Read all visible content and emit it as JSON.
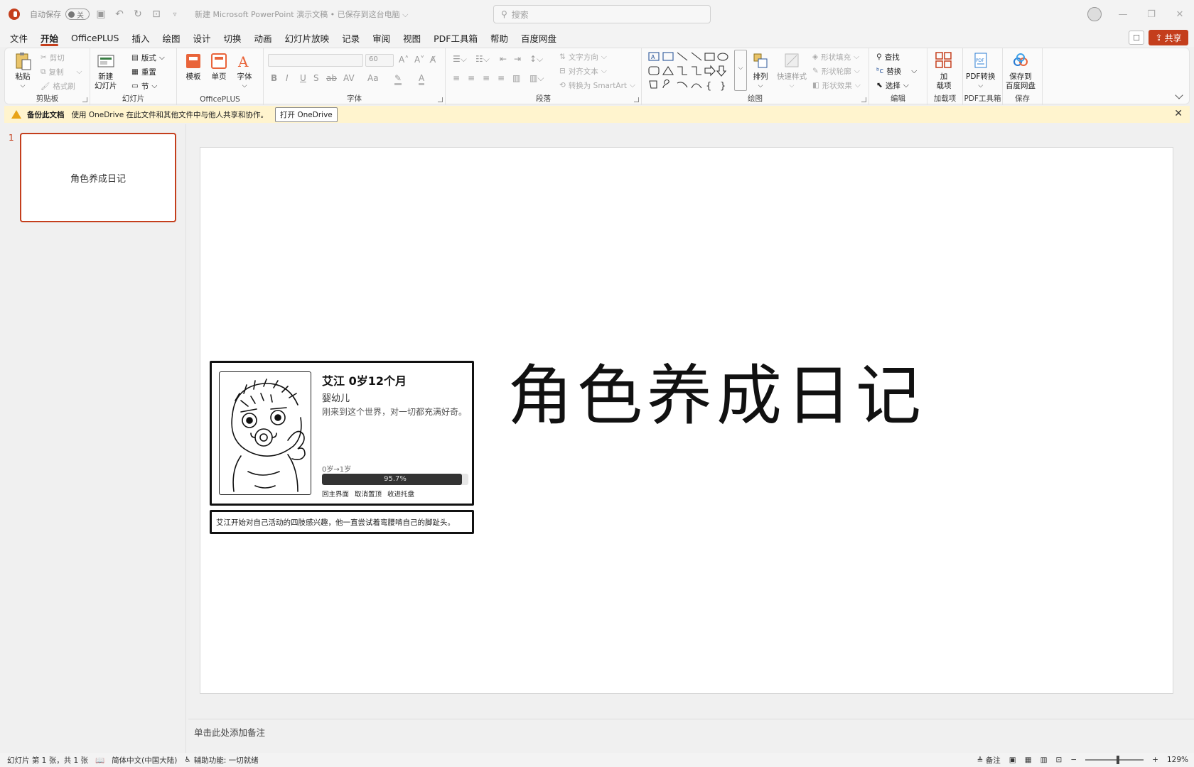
{
  "titlebar": {
    "autosave_label": "自动保存",
    "autosave_state": "关",
    "doc_title": "新建 Microsoft PowerPoint 演示文稿 • 已保存到这台电脑 ⌵",
    "search_placeholder": "搜索"
  },
  "tabs": [
    "文件",
    "开始",
    "OfficePLUS",
    "插入",
    "绘图",
    "设计",
    "切换",
    "动画",
    "幻灯片放映",
    "记录",
    "审阅",
    "视图",
    "PDF工具箱",
    "帮助",
    "百度网盘"
  ],
  "active_tab": "开始",
  "share_label": "共享",
  "ribbon": {
    "clipboard": {
      "paste": "粘贴",
      "cut": "剪切",
      "copy": "复制",
      "format_painter": "格式刷",
      "label": "剪贴板"
    },
    "slides": {
      "new_slide": "新建\n幻灯片",
      "layout": "版式",
      "reset": "重置",
      "section": "节",
      "label": "幻灯片"
    },
    "officeplus": {
      "template": "模板",
      "single_page": "单页",
      "font": "字体",
      "label": "OfficePLUS"
    },
    "font": {
      "size": "60",
      "label": "字体"
    },
    "paragraph": {
      "text_direction": "文字方向",
      "align_text": "对齐文本",
      "smartart": "转换为 SmartArt",
      "label": "段落"
    },
    "drawing": {
      "arrange": "排列",
      "quick_styles": "快速样式",
      "shape_fill": "形状填充",
      "shape_outline": "形状轮廓",
      "shape_effects": "形状效果",
      "label": "绘图"
    },
    "editing": {
      "find": "查找",
      "replace": "替换",
      "select": "选择",
      "label": "编辑"
    },
    "addins": {
      "button": "加\n载项",
      "label": "加载项"
    },
    "pdf": {
      "button": "PDF转换",
      "label": "PDF工具箱"
    },
    "save": {
      "button": "保存到\n百度网盘",
      "label": "保存"
    }
  },
  "notification": {
    "title": "备份此文档",
    "message": "使用 OneDrive 在此文件和其他文件中与他人共享和协作。",
    "button": "打开 OneDrive"
  },
  "thumbnails": [
    {
      "num": "1",
      "title": "角色养成日记"
    }
  ],
  "slide": {
    "title": "角色养成日记",
    "card": {
      "name": "艾江  0岁12个月",
      "stage": "婴幼儿",
      "desc": "刚来到这个世界，对一切都充满好奇。",
      "range": "0岁→1岁",
      "progress": 0.957,
      "progress_text": "95.7%",
      "actions": [
        "回主界面",
        "取消置顶",
        "收进托盘"
      ],
      "bottom_text": "艾江开始对自己活动的四肢感兴趣，他一直尝试着弯腰啃自己的脚趾头。"
    }
  },
  "notes_placeholder": "单击此处添加备注",
  "statusbar": {
    "slide_info": "幻灯片 第 1 张，共 1 张",
    "language": "简体中文(中国大陆)",
    "accessibility": "辅助功能: 一切就绪",
    "notes": "备注",
    "zoom": "129%"
  },
  "colors": {
    "accent": "#c43e1c",
    "notify_bg": "#fff4ce"
  }
}
